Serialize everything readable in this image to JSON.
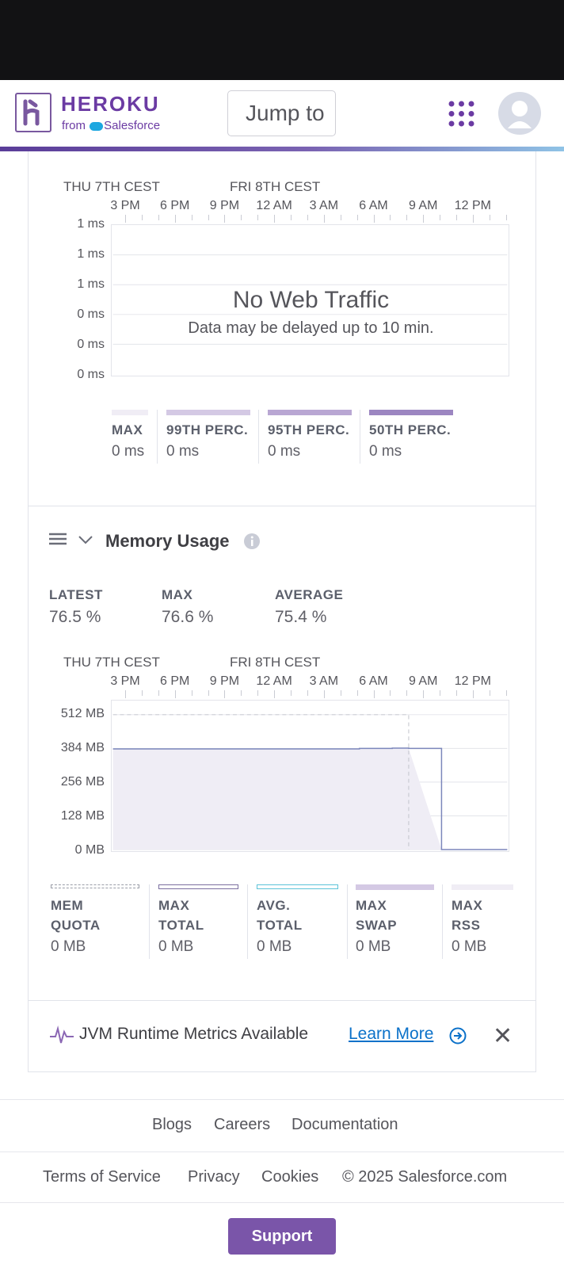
{
  "header": {
    "brand": "HEROKU",
    "brand_sub_from": "from",
    "brand_sub_sf": "Salesforce",
    "search_placeholder": "Jump to"
  },
  "response_time": {
    "day_labels": [
      "THU 7TH CEST",
      "FRI 8TH CEST"
    ],
    "time_ticks": [
      "3 PM",
      "6 PM",
      "9 PM",
      "12 AM",
      "3 AM",
      "6 AM",
      "9 AM",
      "12 PM"
    ],
    "y_labels": [
      "1 ms",
      "1 ms",
      "1 ms",
      "0 ms",
      "0 ms",
      "0 ms"
    ],
    "no_traffic_title": "No Web Traffic",
    "no_traffic_sub": "Data may be delayed up to 10 min.",
    "legend": [
      {
        "name": "MAX",
        "value": "0 ms",
        "color": "#f0edf5"
      },
      {
        "name": "99TH PERC.",
        "value": "0 ms",
        "color": "#d4c9e4"
      },
      {
        "name": "95TH PERC.",
        "value": "0 ms",
        "color": "#b9a7d3"
      },
      {
        "name": "50TH PERC.",
        "value": "0 ms",
        "color": "#9c86c1"
      }
    ]
  },
  "memory": {
    "title": "Memory Usage",
    "stats": [
      {
        "label": "LATEST",
        "value": "76.5 %"
      },
      {
        "label": "MAX",
        "value": "76.6 %"
      },
      {
        "label": "AVERAGE",
        "value": "75.4 %"
      }
    ],
    "legend": [
      {
        "name_line1": "MEM",
        "name_line2": "QUOTA",
        "value": "0 MB"
      },
      {
        "name_line1": "MAX",
        "name_line2": "TOTAL",
        "value": "0 MB"
      },
      {
        "name_line1": "AVG.",
        "name_line2": "TOTAL",
        "value": "0 MB"
      },
      {
        "name_line1": "MAX",
        "name_line2": "SWAP",
        "value": "0 MB"
      },
      {
        "name_line1": "MAX",
        "name_line2": "RSS",
        "value": "0 MB"
      }
    ]
  },
  "chart_data": [
    {
      "type": "line",
      "title": "",
      "x_ticks": [
        "3 PM",
        "6 PM",
        "9 PM",
        "12 AM",
        "3 AM",
        "6 AM",
        "9 AM",
        "12 PM"
      ],
      "y_tick_labels": [
        "1 ms",
        "1 ms",
        "1 ms",
        "0 ms",
        "0 ms",
        "0 ms"
      ],
      "series": [],
      "annotation": "No Web Traffic"
    },
    {
      "type": "area",
      "title": "",
      "x_ticks": [
        "3 PM",
        "6 PM",
        "9 PM",
        "12 AM",
        "3 AM",
        "6 AM",
        "9 AM",
        "12 PM"
      ],
      "y_ticks": [
        0,
        128,
        256,
        384,
        512
      ],
      "y_tick_labels": [
        "512 MB",
        "384 MB",
        "256 MB",
        "128 MB",
        "0 MB"
      ],
      "ylim": [
        0,
        512
      ],
      "x_hours": [
        0,
        3,
        6,
        9,
        12,
        15,
        17,
        18,
        20,
        21,
        24
      ],
      "series": [
        {
          "values": [
            382,
            382,
            382,
            382,
            382,
            384,
            385,
            384,
            0,
            0,
            0
          ]
        },
        {
          "values": [
            512,
            512,
            512,
            512,
            512,
            512,
            512,
            512,
            null,
            null,
            null
          ]
        }
      ]
    }
  ],
  "jvm": {
    "text": "JVM Runtime Metrics Available",
    "link": "Learn More"
  },
  "footer": {
    "row1": [
      "Blogs",
      "Careers",
      "Documentation"
    ],
    "row2": [
      "Terms of Service",
      "Privacy",
      "Cookies",
      "© 2025 Salesforce.com"
    ],
    "support": "Support"
  }
}
